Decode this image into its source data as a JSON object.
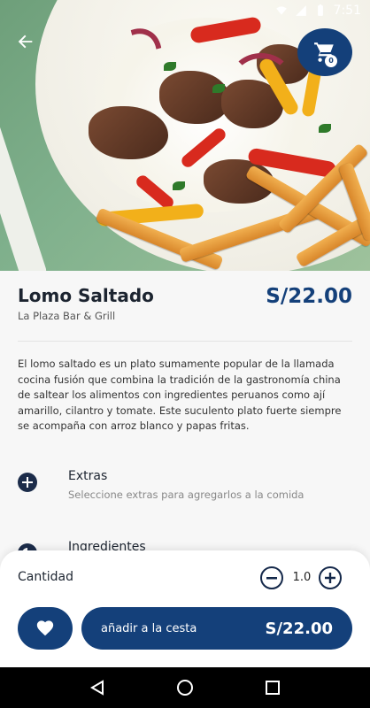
{
  "status": {
    "time": "7:51"
  },
  "header": {
    "back_icon": "arrow-left-icon",
    "cart_icon": "cart-icon",
    "cart_count": "0"
  },
  "product": {
    "name": "Lomo Saltado",
    "restaurant": "La Plaza Bar & Grill",
    "price": "S/22.00",
    "description": "El lomo saltado es un plato sumamente popular de la llamada cocina fusión que combina la tradición de la gastronomía china de saltear los alimentos con ingredientes peruanos como ají amarillo, cilantro y tomate. Este suculento plato fuerte siempre se acompaña con arroz blanco y papas fritas."
  },
  "sections": [
    {
      "title": "Extras",
      "subtitle": "Seleccione extras para agregarlos a la comida",
      "icon": "plus-circle-icon"
    },
    {
      "title": "Ingredientes",
      "icon": "pie-chart-icon"
    }
  ],
  "cart_sheet": {
    "quantity_label": "Cantidad",
    "quantity_value": "1.0",
    "add_label": "añadir a la cesta",
    "add_price": "S/22.00",
    "favorite_icon": "heart-icon"
  },
  "colors": {
    "primary": "#14407a",
    "dark": "#1c2430"
  }
}
